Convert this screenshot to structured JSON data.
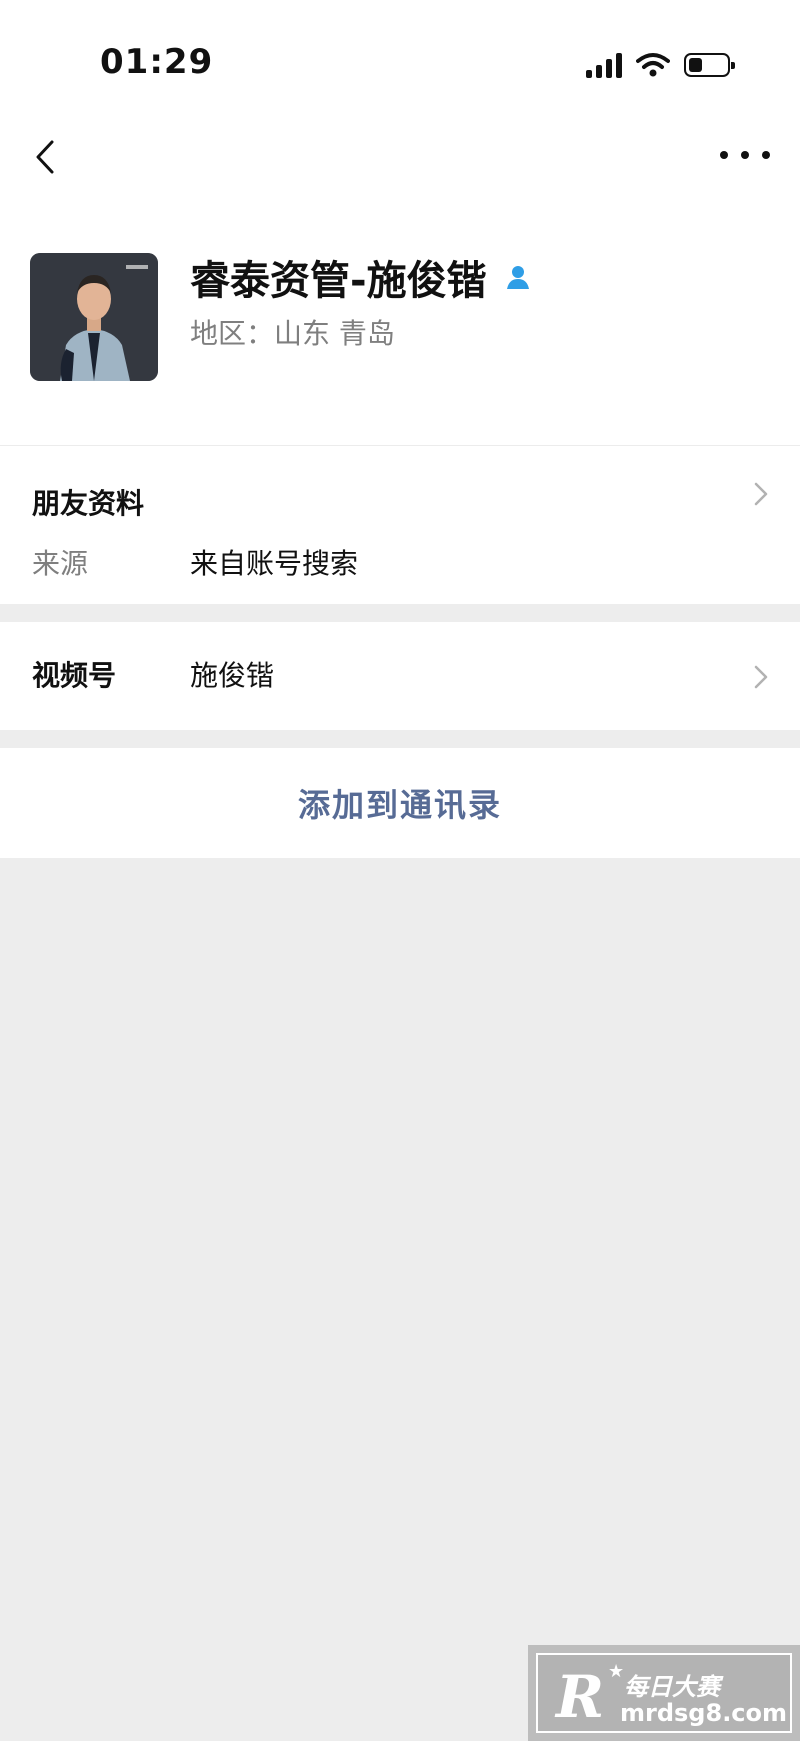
{
  "status_bar": {
    "time": "01:29"
  },
  "profile": {
    "name": "睿泰资管-施俊锴",
    "region": "地区：山东 青岛"
  },
  "friend_info": {
    "title": "朋友资料",
    "source_label": "来源",
    "source_value": "来自账号搜索"
  },
  "channels": {
    "label": "视频号",
    "value": "施俊锴"
  },
  "actions": {
    "add_to_contacts": "添加到通讯录"
  },
  "watermark": {
    "brand": "每日大赛",
    "url": "mrdsg8.com"
  },
  "colors": {
    "link": "#576b95",
    "verified_icon": "#2f9ee6",
    "background": "#ededed"
  }
}
